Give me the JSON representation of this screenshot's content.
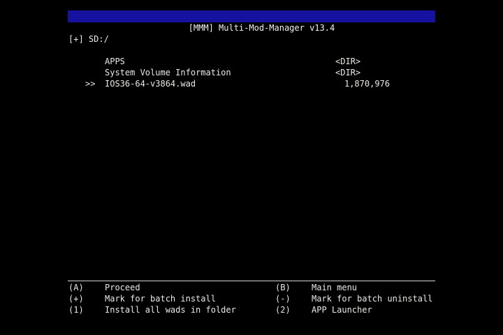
{
  "app": {
    "title": "[MMM] Multi-Mod-Manager v13.4"
  },
  "path": {
    "text": "[+] SD:/"
  },
  "files": [
    {
      "cursor": "",
      "name": "APPS",
      "info": "<DIR>",
      "is_dir": true
    },
    {
      "cursor": "",
      "name": "System Volume Information",
      "info": "<DIR>",
      "is_dir": true
    },
    {
      "cursor": ">>",
      "name": "IOS36-64-v3864.wad",
      "info": "1,870,976",
      "is_dir": false
    }
  ],
  "help": [
    {
      "left_key": "(A)",
      "left_desc": "Proceed",
      "right_key": "(B)",
      "right_desc": "Main menu"
    },
    {
      "left_key": "(+)",
      "left_desc": "Mark for batch install",
      "right_key": "(-)",
      "right_desc": "Mark for batch uninstall"
    },
    {
      "left_key": "(1)",
      "left_desc": "Install all wads in folder",
      "right_key": "(2)",
      "right_desc": "APP Launcher"
    }
  ],
  "colors": {
    "background": "#000000",
    "title_bar": "#14129e",
    "text": "#ece8e4"
  }
}
